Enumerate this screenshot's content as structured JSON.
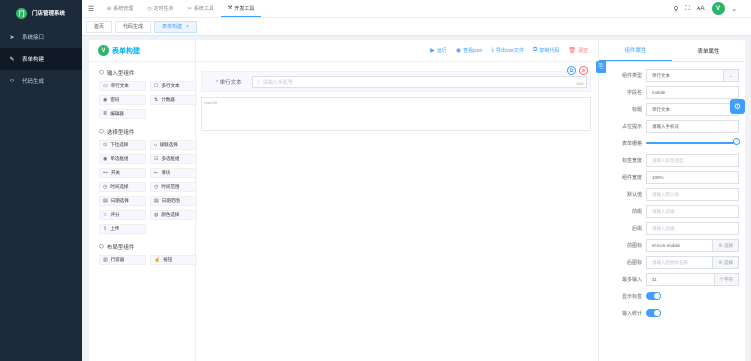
{
  "app": {
    "name": "门店管理系统",
    "logo_letter": "门"
  },
  "sidebar": {
    "items": [
      {
        "icon": "➤",
        "label": "系统接口",
        "active": false
      },
      {
        "icon": "✎",
        "label": "表单构建",
        "active": true
      },
      {
        "icon": "‹›",
        "label": "代码生成",
        "active": false
      }
    ]
  },
  "topbar": {
    "menu": [
      {
        "icon": "⊞",
        "label": "系统管理"
      },
      {
        "icon": "◷",
        "label": "定时任务"
      },
      {
        "icon": "✂",
        "label": "系统工具"
      },
      {
        "icon": "⚒",
        "label": "开发工具"
      }
    ],
    "avatar_letter": "V"
  },
  "tags": [
    {
      "label": "首页",
      "active": false
    },
    {
      "label": "代码生成",
      "active": false
    },
    {
      "label": "表单构建",
      "active": true
    }
  ],
  "left_panel": {
    "title": "表单构建",
    "logo_letter": "V",
    "groups": [
      {
        "title": "输入型组件",
        "items": [
          {
            "icon": "▭",
            "label": "单行文本"
          },
          {
            "icon": "☐",
            "label": "多行文本"
          },
          {
            "icon": "◉",
            "label": "密码"
          },
          {
            "icon": "⇅",
            "label": "计数器"
          },
          {
            "icon": "≣",
            "label": "编辑器"
          }
        ]
      },
      {
        "title": "选择型组件",
        "items": [
          {
            "icon": "⊙",
            "label": "下拉选择"
          },
          {
            "icon": "⤷",
            "label": "级联选择"
          },
          {
            "icon": "◉",
            "label": "单选框组"
          },
          {
            "icon": "☑",
            "label": "多选框组"
          },
          {
            "icon": "⊷",
            "label": "开关"
          },
          {
            "icon": "⇜",
            "label": "滑块"
          },
          {
            "icon": "◷",
            "label": "时间选择"
          },
          {
            "icon": "◷",
            "label": "时间范围"
          },
          {
            "icon": "▤",
            "label": "日期选择"
          },
          {
            "icon": "▤",
            "label": "日期范围"
          },
          {
            "icon": "☆",
            "label": "评分"
          },
          {
            "icon": "◍",
            "label": "颜色选择"
          },
          {
            "icon": "⇪",
            "label": "上传"
          }
        ]
      },
      {
        "title": "布局型组件",
        "items": [
          {
            "icon": "▥",
            "label": "行容器"
          },
          {
            "icon": "☝",
            "label": "按钮"
          }
        ]
      }
    ]
  },
  "actions": [
    {
      "icon": "▶",
      "label": "运行"
    },
    {
      "icon": "◉",
      "label": "查看json"
    },
    {
      "icon": "⤓",
      "label": "导出vue文件"
    },
    {
      "icon": "⧉",
      "label": "复制代码"
    },
    {
      "icon": "🗑",
      "label": "清空"
    }
  ],
  "canvas": {
    "field": {
      "label": "单行文本",
      "placeholder": "请输入手机号",
      "counter": "0/11",
      "prefix_icon": "▯"
    },
    "row_actions": {
      "copy": "⧉",
      "delete": "⊗"
    },
    "drop_label": "row100"
  },
  "right_panel": {
    "tabs": [
      {
        "label": "组件属性",
        "active": true
      },
      {
        "label": "表单属性",
        "active": false
      }
    ],
    "props": [
      {
        "label": "组件类型",
        "value": "单行文本",
        "placeholder": false,
        "suffix": "⌄"
      },
      {
        "label": "字段名",
        "value": "mobile",
        "placeholder": false,
        "suffix": ""
      },
      {
        "label": "标题",
        "value": "单行文本",
        "placeholder": false,
        "suffix": ""
      },
      {
        "label": "占位提示",
        "value": "请输入手机号",
        "placeholder": false,
        "suffix": ""
      },
      {
        "label": "表单栅格",
        "type": "slider",
        "value": 24
      },
      {
        "label": "标签宽度",
        "value": "请输入标签宽度",
        "placeholder": true,
        "suffix": ""
      },
      {
        "label": "组件宽度",
        "value": "100%",
        "placeholder": false,
        "suffix": ""
      },
      {
        "label": "默认值",
        "value": "请输入默认值",
        "placeholder": true,
        "suffix": ""
      },
      {
        "label": "前缀",
        "value": "请输入前缀",
        "placeholder": true,
        "suffix": ""
      },
      {
        "label": "后缀",
        "value": "请输入后缀",
        "placeholder": true,
        "suffix": ""
      },
      {
        "label": "前图标",
        "value": "el-icon-mobile",
        "placeholder": false,
        "suffix": "⊕ 选择"
      },
      {
        "label": "后图标",
        "value": "请输入后图标名称",
        "placeholder": true,
        "suffix": "⊕ 选择"
      },
      {
        "label": "最多输入",
        "value": "11",
        "placeholder": false,
        "suffix": "个字符"
      },
      {
        "label": "显示标签",
        "type": "toggle",
        "value": true
      },
      {
        "label": "输入统计",
        "type": "toggle",
        "value": true
      }
    ]
  },
  "fab_icon": "⚙",
  "side_tool_icon": "⎘",
  "colors": {
    "primary": "#409eff",
    "sidebar": "#1c2a3a",
    "brand_green": "#2fb56b",
    "danger": "#f56c6c"
  }
}
